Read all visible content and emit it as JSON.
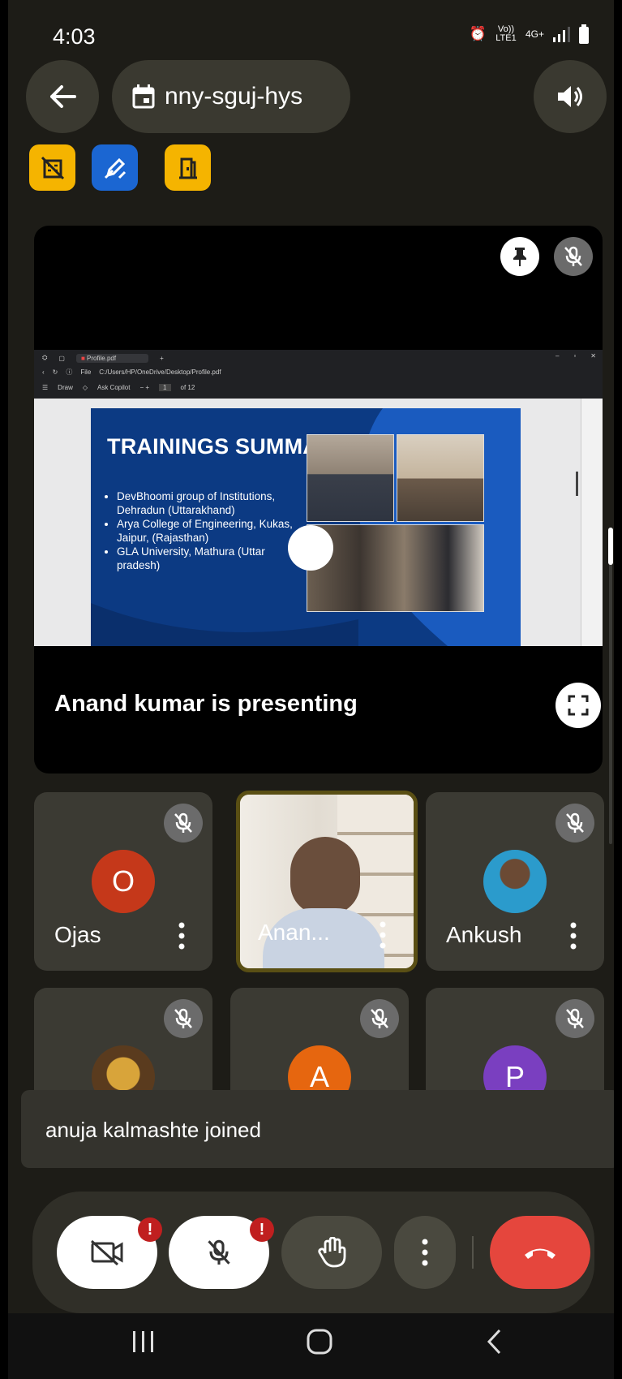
{
  "status_bar": {
    "time": "4:03",
    "network": "Vo)) LTE1",
    "signal_type": "4G+"
  },
  "header": {
    "meeting_code": "nny-sguj-hys"
  },
  "stage": {
    "presenter_label": "Anand kumar is presenting",
    "browser": {
      "tab_title": "Profile.pdf",
      "address": "C:/Users/HP/OneDrive/Desktop/Profile.pdf",
      "file_label": "File",
      "draw_label": "Draw",
      "copilot_label": "Ask Copilot",
      "page_number": "1",
      "page_total": "of 12"
    },
    "slide": {
      "title": "TRAININGS SUMMARY",
      "bullets": [
        "DevBhoomi group of Institutions, Dehradun (Uttarakhand)",
        "Arya College of Engineering, Kukas, Jaipur, (Rajasthan)",
        "GLA University, Mathura (Uttar pradesh)"
      ]
    }
  },
  "participants": [
    {
      "name": "Ojas",
      "initial": "O",
      "color": "#c5381a"
    },
    {
      "name": "Anan..."
    },
    {
      "name": "Ankush"
    },
    {
      "name": ""
    },
    {
      "name": "",
      "initial": "A",
      "color": "#e6660f"
    },
    {
      "name": "",
      "initial": "P",
      "color": "#7a3fc0"
    }
  ],
  "toast": {
    "message": "anuja kalmashte joined"
  },
  "controls": {
    "camera_badge": "!",
    "mic_badge": "!"
  }
}
